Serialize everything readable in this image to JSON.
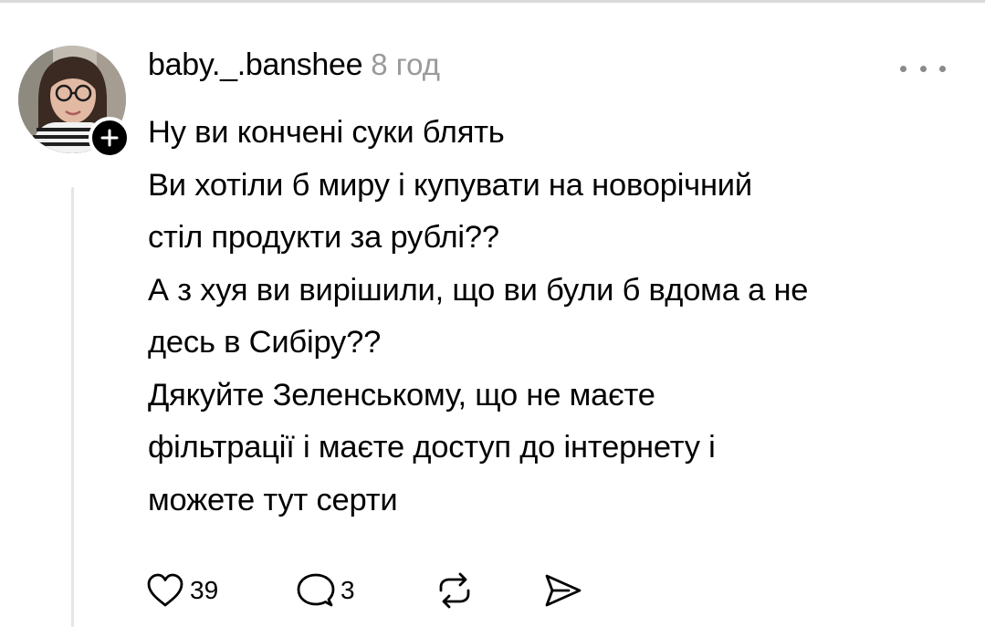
{
  "post": {
    "username": "baby._.banshee",
    "timestamp": "8 год",
    "lines": [
      "Ну ви кончені суки блять",
      "Ви хотіли б миру і купувати на новорічний",
      "стіл продукти за рублі??",
      "А з хуя ви вирішили, що ви були б вдома а не",
      "десь в Сибіру??",
      "Дякуйте Зеленському, що не маєте",
      "фільтрації і маєте доступ до інтернету і",
      "можете тут серти"
    ]
  },
  "actions": {
    "likes": "39",
    "comments": "3"
  },
  "icons": {
    "like": "heart-icon",
    "comment": "speech-bubble-icon",
    "repost": "repost-icon",
    "share": "send-icon",
    "more": "more-dots-icon",
    "follow": "plus-icon"
  },
  "colors": {
    "text": "#000000",
    "muted": "#9a9a9a",
    "thread_line": "#e6e6e6"
  }
}
